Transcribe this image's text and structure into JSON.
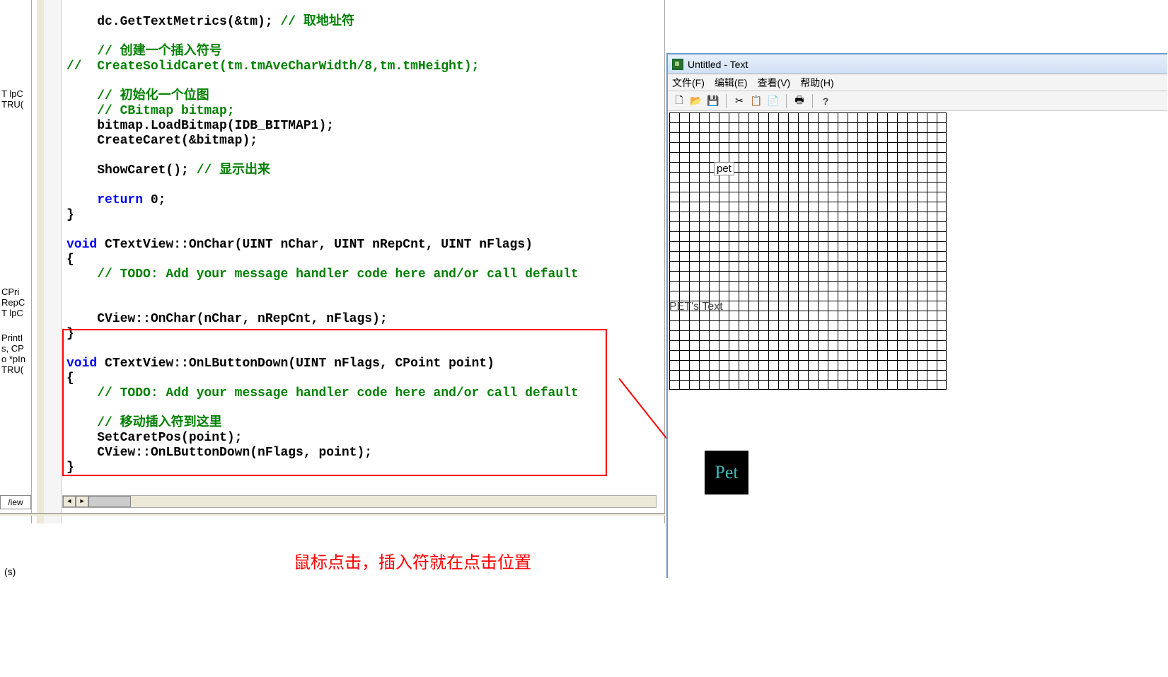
{
  "leftFragment": {
    "items": [
      "",
      "",
      "",
      "",
      "",
      "T lpC",
      "TRU(",
      "",
      "",
      "",
      "",
      "",
      "",
      "",
      "",
      "",
      "",
      "",
      "",
      "CPri",
      "RepC",
      "T lpC",
      "",
      "PrintI",
      "s, CP",
      "o *pIn",
      "TRU("
    ]
  },
  "code": {
    "l1_a": "    dc.GetTextMetrics(&tm); ",
    "l1_b": "// 取地址符",
    "l2": "",
    "l3_a": "    ",
    "l3_b": "// 创建一个插入符号",
    "l4": "//  CreateSolidCaret(tm.tmAveCharWidth/8,tm.tmHeight);",
    "l5": "",
    "l6_a": "    ",
    "l6_b": "// 初始化一个位图",
    "l7": "    // CBitmap bitmap;",
    "l8": "    bitmap.LoadBitmap(IDB_BITMAP1);",
    "l9": "    CreateCaret(&bitmap);",
    "l10": "",
    "l11_a": "    ShowCaret(); ",
    "l11_b": "// 显示出来",
    "l12": "",
    "l13_a": "    ",
    "l13_kw": "return",
    "l13_b": " 0;",
    "l14": "}",
    "l15": "",
    "l16_kw": "void",
    "l16_a": " CTextView::OnChar(UINT nChar, UINT nRepCnt, UINT nFlags)",
    "l17": "{",
    "l18_a": "    ",
    "l18_b": "// TODO: Add your message handler code here and/or call default",
    "l19": "",
    "l20": "",
    "l21": "    CView::OnChar(nChar, nRepCnt, nFlags);",
    "l22": "}",
    "l23": "",
    "l24_kw": "void",
    "l24_a": " CTextView::OnLButtonDown(UINT nFlags, CPoint point)",
    "l25": "{",
    "l26_a": "    ",
    "l26_b": "// TODO: Add your message handler code here and/or call default",
    "l27": "",
    "l28_a": "    ",
    "l28_b": "// 移动插入符到这里",
    "l29": "    SetCaretPos(point);",
    "l30": "    CView::OnLButtonDown(nFlags, point);",
    "l31": "}"
  },
  "tab": {
    "label": "/iew"
  },
  "status": {
    "text": "(s)"
  },
  "annotation": {
    "text": "鼠标点击，插入符就在点击位置"
  },
  "app": {
    "title": "Untitled - Text",
    "menu": {
      "file": "文件(F)",
      "edit": "编辑(E)",
      "view": "查看(V)",
      "help": "帮助(H)"
    },
    "toolbar": {
      "new": "🗋",
      "open": "📂",
      "save": "💾",
      "cut": "✂",
      "copy": "📋",
      "paste": "📄",
      "print": "🖶",
      "help": "?"
    },
    "gridLabel1": "pet",
    "gridLabel2": "PET's Text",
    "bitmapText": "Pet"
  }
}
